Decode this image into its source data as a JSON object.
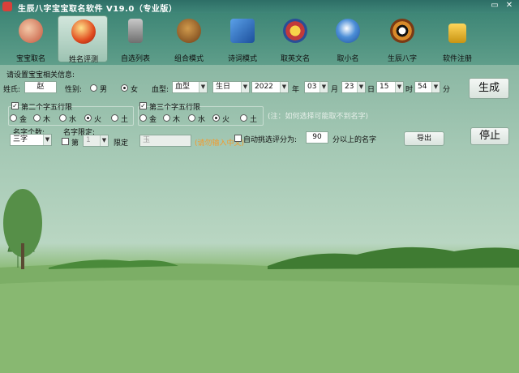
{
  "window": {
    "title": "生辰八字宝宝取名软件 V19.0（专业版）",
    "controls": [
      "▭",
      "✕"
    ]
  },
  "toolbar": {
    "items": [
      {
        "label": "宝宝取名",
        "icon": "baby-portrait-icon",
        "active": false
      },
      {
        "label": "姓名评测",
        "icon": "fortune-orb-icon",
        "active": true
      },
      {
        "label": "自选列表",
        "icon": "brush-pot-icon",
        "active": false
      },
      {
        "label": "组合模式",
        "icon": "lion-head-icon",
        "active": false
      },
      {
        "label": "诗词模式",
        "icon": "book-icon",
        "active": false
      },
      {
        "label": "取英文名",
        "icon": "badge-icon",
        "active": false
      },
      {
        "label": "取小名",
        "icon": "blue-bird-icon",
        "active": false
      },
      {
        "label": "生辰八字",
        "icon": "bagua-icon",
        "active": false
      },
      {
        "label": "软件注册",
        "icon": "padlock-icon",
        "active": false
      }
    ]
  },
  "form": {
    "section_title": "请设置宝宝相关信息:",
    "surname_label": "姓氏:",
    "surname_value": "赵",
    "gender_label": "性别:",
    "gender_male": "男",
    "gender_female": "女",
    "gender_selected": "女",
    "blood_label": "血型:",
    "blood_value": "血型",
    "calendar_value": "生日",
    "year_value": "2022",
    "year_unit": "年",
    "month_value": "03",
    "month_unit": "月",
    "day_value": "23",
    "day_unit": "日",
    "hour_value": "15",
    "hour_unit": "时",
    "minute_value": "54",
    "minute_unit": "分",
    "generate_label": "生成",
    "wuxing2_title": "第二个字五行限",
    "wuxing2_checked": true,
    "wuxing3_title": "第三个字五行限",
    "wuxing3_checked": true,
    "elements": [
      "金",
      "木",
      "水",
      "火",
      "土"
    ],
    "wuxing2_selected": "火",
    "wuxing3_selected": "火",
    "hint_text": "(注：如何选择可能取不到名字)",
    "name_count_label": "名字个数:",
    "name_count_value": "三字",
    "name_limit_label": "名字限定:",
    "limit_check_label": "第",
    "limit_position_value": "1",
    "limit_label": "限定",
    "limit_char_value": "玉",
    "limit_hint": "(请勿输入中文)",
    "auto_filter_label": "自动挑选评分为:",
    "score_value": "90",
    "score_suffix": "分以上的名字",
    "export_label": "导出",
    "stop_label": "停止"
  }
}
